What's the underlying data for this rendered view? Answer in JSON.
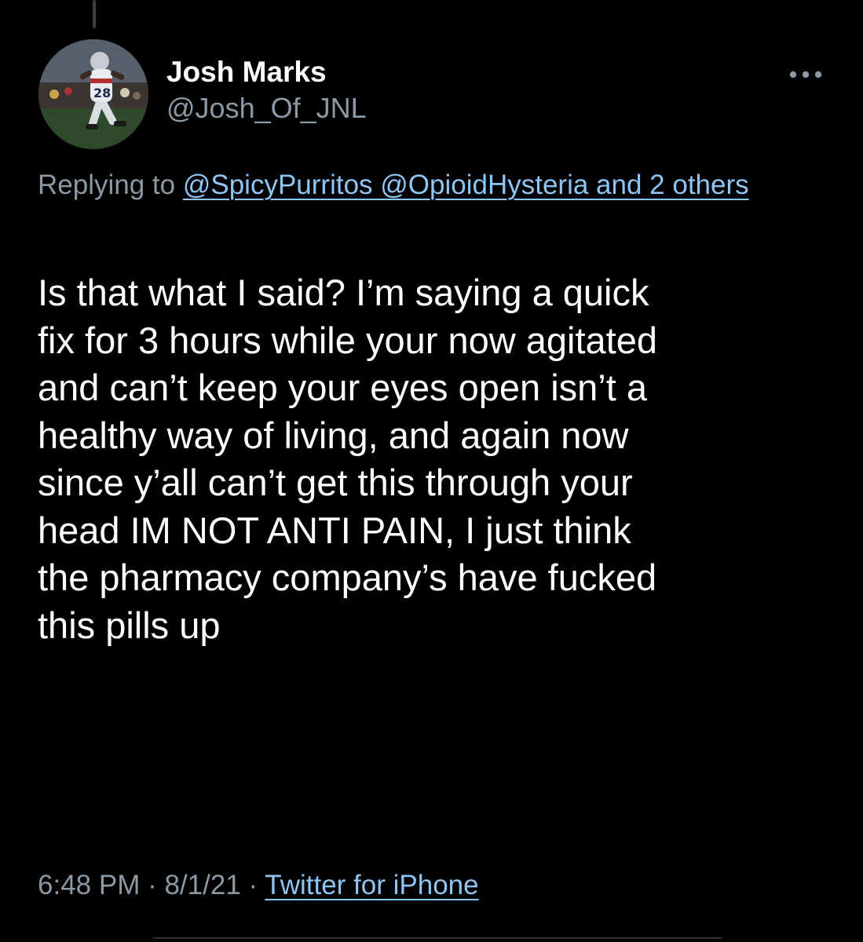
{
  "tweet": {
    "author": {
      "display_name": "Josh Marks",
      "handle": "@Josh_Of_JNL"
    },
    "more_icon": "more-horizontal-icon",
    "reply_context": {
      "prefix": "Replying to",
      "mentions": "@SpicyPurritos @OpioidHysteria and 2 others"
    },
    "text": "Is that what I said? I’m saying a quick\nfix for 3 hours while your now agitated\nand can’t keep your eyes open isn’t a\nhealthy way of living, and again now\nsince y’all can’t get this through your\nhead IM NOT ANTI PAIN, I just think\nthe pharmacy company’s have fucked\nthis pills up",
    "meta": {
      "time": "6:48 PM",
      "separator": " · ",
      "date": "8/1/21",
      "source": "Twitter for iPhone"
    }
  },
  "colors": {
    "background": "#000000",
    "primary_text": "#ffffff",
    "secondary_text": "#8b98a5",
    "link": "#8ec5f4",
    "divider": "#2f3336"
  }
}
